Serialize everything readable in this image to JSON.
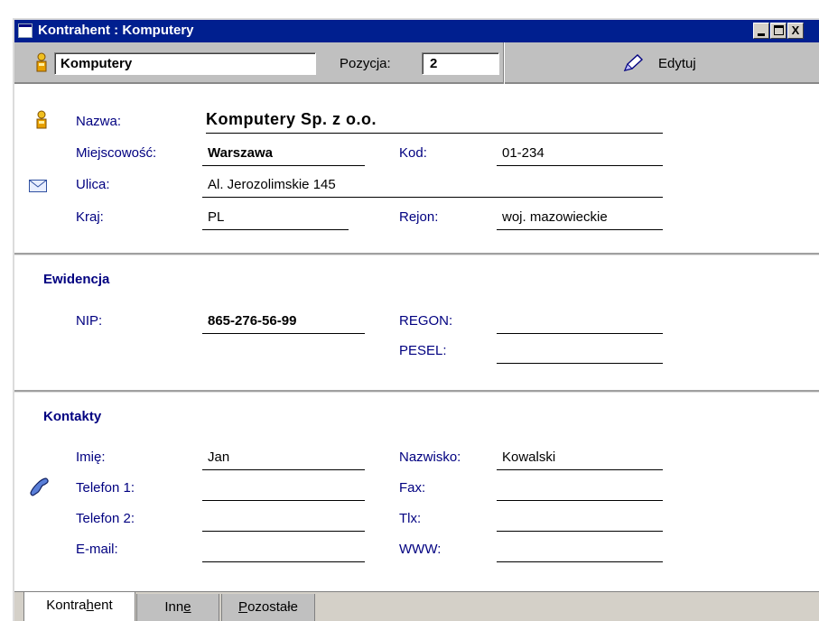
{
  "window": {
    "title": "Kontrahent : Komputery",
    "controls": {
      "minimize": "",
      "maximize": "",
      "close": "X"
    }
  },
  "toolbar": {
    "name_value": "Komputery",
    "position_label": "Pozycja:",
    "position_value": "2",
    "edit_label": "Edytuj",
    "icons": {
      "person": "person-icon",
      "edit": "pencil-icon"
    }
  },
  "address": {
    "nazwa_label": "Nazwa:",
    "nazwa_value": "Komputery Sp. z o.o.",
    "miejscowosc_label": "Miejscowość:",
    "miejscowosc_value": "Warszawa",
    "kod_label": "Kod:",
    "kod_value": "01-234",
    "ulica_label": "Ulica:",
    "ulica_value": "Al. Jerozolimskie 145",
    "kraj_label": "Kraj:",
    "kraj_value": "PL",
    "rejon_label": "Rejon:",
    "rejon_value": "woj. mazowieckie",
    "icons": {
      "person": "person-icon",
      "mail": "envelope-icon"
    }
  },
  "ewidencja": {
    "title": "Ewidencja",
    "nip_label": "NIP:",
    "nip_value": "865-276-56-99",
    "regon_label": "REGON:",
    "regon_value": "",
    "pesel_label": "PESEL:",
    "pesel_value": ""
  },
  "kontakty": {
    "title": "Kontakty",
    "imie_label": "Imię:",
    "imie_value": "Jan",
    "nazwisko_label": "Nazwisko:",
    "nazwisko_value": "Kowalski",
    "telefon1_label": "Telefon 1:",
    "telefon1_value": "",
    "fax_label": "Fax:",
    "fax_value": "",
    "telefon2_label": "Telefon 2:",
    "telefon2_value": "",
    "tlx_label": "Tlx:",
    "tlx_value": "",
    "email_label": "E-mail:",
    "email_value": "",
    "www_label": "WWW:",
    "www_value": "",
    "icons": {
      "phone": "phone-icon"
    }
  },
  "tabs": {
    "kontrahent": {
      "before": "Kontra",
      "underlined": "h",
      "after": "ent"
    },
    "inne": {
      "before": "Inn",
      "underlined": "e",
      "after": ""
    },
    "pozostale": {
      "before": "",
      "underlined": "P",
      "after": "ozostałe"
    }
  },
  "colors": {
    "titlebar": "#001f8f",
    "label_text": "#000080",
    "toolbar_bg": "#c0c0c0"
  }
}
